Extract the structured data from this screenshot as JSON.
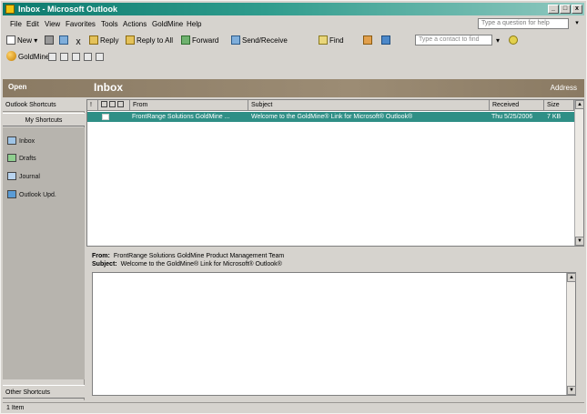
{
  "window": {
    "title": "Inbox - Microsoft Outlook",
    "min_label": "_",
    "max_label": "□",
    "close_label": "x"
  },
  "menu": {
    "items": [
      "File",
      "Edit",
      "View",
      "Favorites",
      "Tools",
      "Actions",
      "GoldMine",
      "Help"
    ],
    "help_placeholder": "Type a question for help",
    "help_arrow": "▾"
  },
  "toolbar1": {
    "new": "New",
    "new_arrow": "▾",
    "delete_glyph": "X",
    "reply": "Reply",
    "reply_all": "Reply to All",
    "forward": "Forward",
    "send_receive": "Send/Receive",
    "find": "Find",
    "contacts_placeholder": "Type a contact to find",
    "contacts_arrow": "▾"
  },
  "toolbar2": {
    "goldmine": "GoldMine"
  },
  "folderbar": {
    "open_label": "Open",
    "title": "Inbox",
    "address": "Address"
  },
  "shortcuts": {
    "header": "Outlook Shortcuts",
    "my_shortcuts": "My Shortcuts",
    "items": [
      "Inbox",
      "Drafts",
      "Journal",
      "Outlook Upd."
    ],
    "other": "Other Shortcuts"
  },
  "messages": {
    "columns": [
      "! ",
      "From",
      "Subject",
      "Received",
      "Size"
    ],
    "rows": [
      {
        "from": "FrontRange Solutions GoldMine ...",
        "subject": "Welcome to the GoldMine® Link for Microsoft® Outlook®",
        "received": "Thu 5/25/2006",
        "size": "7 KB"
      }
    ]
  },
  "preview": {
    "from_label": "From:",
    "from_value": "FrontRange Solutions GoldMine Product Management Team",
    "subject_label": "Subject:",
    "subject_value": "Welcome to the GoldMine® Link for Microsoft® Outlook®"
  },
  "status": {
    "text": "1 Item"
  }
}
